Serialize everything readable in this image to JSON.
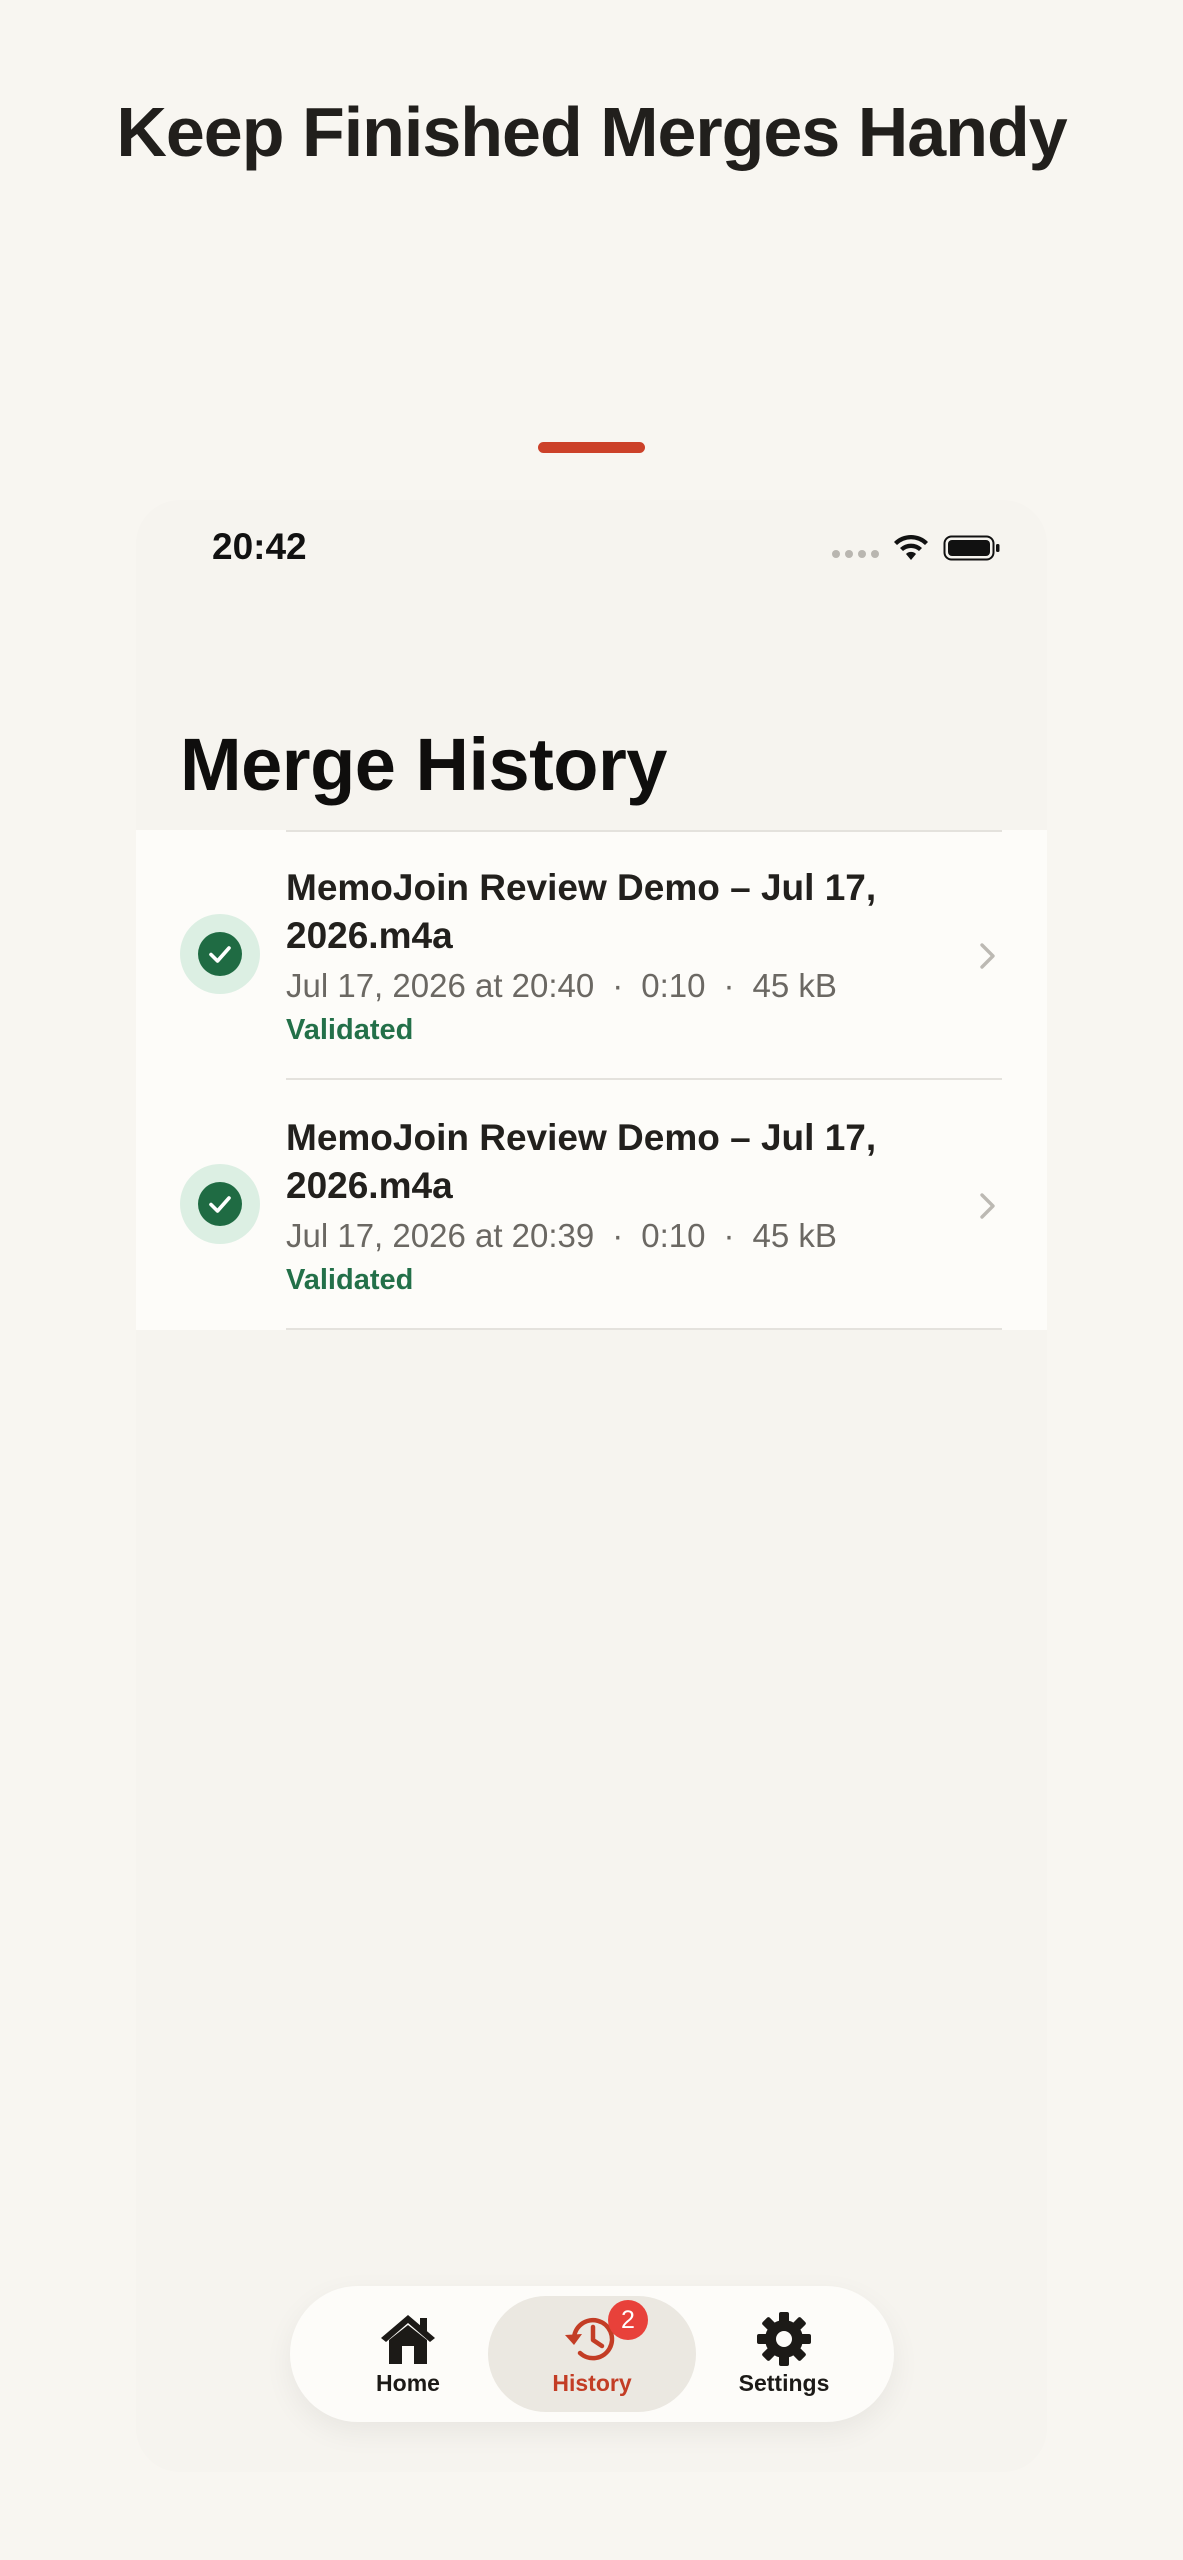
{
  "headline": "Keep Finished Merges Handy",
  "colors": {
    "accent": "#cc4129",
    "validated": "#237049",
    "badge": "#e8413a",
    "background": "#f8f6f1"
  },
  "status_bar": {
    "time": "20:42",
    "icons": [
      "signal-icon",
      "wifi-icon",
      "battery-icon"
    ]
  },
  "screen": {
    "title": "Merge History"
  },
  "history": [
    {
      "title": "MemoJoin Review Demo – Jul 17, 2026.m4a",
      "date": "Jul 17, 2026 at 20:40",
      "duration": "0:10",
      "size": "45 kB",
      "status": "Validated",
      "separator": "·"
    },
    {
      "title": "MemoJoin Review Demo – Jul 17, 2026.m4a",
      "date": "Jul 17, 2026 at 20:39",
      "duration": "0:10",
      "size": "45 kB",
      "status": "Validated",
      "separator": "·"
    }
  ],
  "tabbar": {
    "home": {
      "label": "Home",
      "icon": "home-icon"
    },
    "history": {
      "label": "History",
      "icon": "history-icon",
      "badge": "2",
      "selected": true
    },
    "settings": {
      "label": "Settings",
      "icon": "gear-icon"
    }
  }
}
